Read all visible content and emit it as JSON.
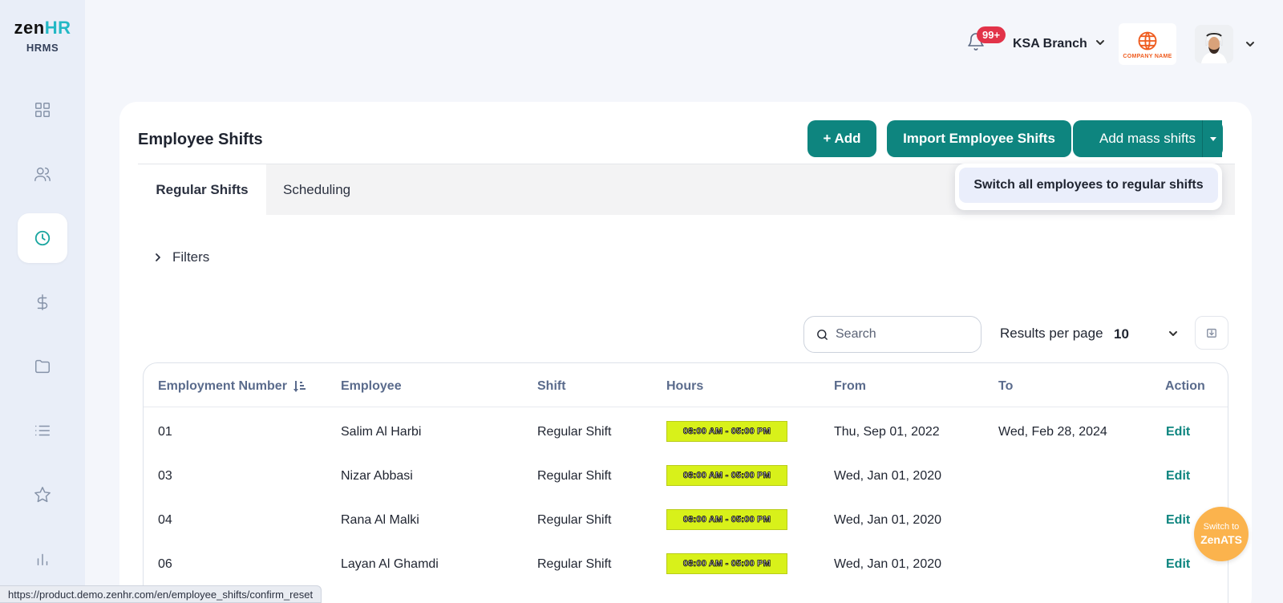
{
  "app": {
    "logo_prefix": "zen",
    "logo_suffix": "HR",
    "logo_sub": "HRMS"
  },
  "sidebar": {
    "items": [
      {
        "icon": "dashboard-icon",
        "active": false
      },
      {
        "icon": "users-icon",
        "active": false
      },
      {
        "icon": "clock-icon",
        "active": true
      },
      {
        "icon": "dollar-icon",
        "active": false
      },
      {
        "icon": "folder-icon",
        "active": false
      },
      {
        "icon": "list-icon",
        "active": false
      },
      {
        "icon": "star-icon",
        "active": false
      },
      {
        "icon": "bar-chart-icon",
        "active": false
      }
    ]
  },
  "header": {
    "notifications_badge": "99+",
    "branch": "KSA Branch",
    "company_logo_text": "COMPANY NAME"
  },
  "page": {
    "title": "Employee Shifts",
    "buttons": {
      "add": "+ Add",
      "import": "Import Employee Shifts",
      "mass": "Add mass shifts"
    },
    "dropdown_item": "Switch all employees to regular shifts",
    "tabs": [
      {
        "label": "Regular Shifts",
        "active": true
      },
      {
        "label": "Scheduling",
        "active": false
      }
    ],
    "filters_label": "Filters",
    "search_placeholder": "Search",
    "results_per_page_label": "Results per page",
    "results_per_page_value": "10"
  },
  "table": {
    "columns": [
      "Employment Number",
      "Employee",
      "Shift",
      "Hours",
      "From",
      "To",
      "Action"
    ],
    "rows": [
      {
        "number": "01",
        "employee": "Salim Al Harbi",
        "shift": "Regular Shift",
        "hours": "08:00 AM - 05:00 PM",
        "from": "Thu, Sep 01, 2022",
        "to": "Wed, Feb 28, 2024",
        "action": "Edit"
      },
      {
        "number": "03",
        "employee": "Nizar Abbasi",
        "shift": "Regular Shift",
        "hours": "08:00 AM - 05:00 PM",
        "from": "Wed, Jan 01, 2020",
        "to": "",
        "action": "Edit"
      },
      {
        "number": "04",
        "employee": "Rana Al Malki",
        "shift": "Regular Shift",
        "hours": "08:00 AM - 05:00 PM",
        "from": "Wed, Jan 01, 2020",
        "to": "",
        "action": "Edit"
      },
      {
        "number": "06",
        "employee": "Layan Al Ghamdi",
        "shift": "Regular Shift",
        "hours": "08:00 AM - 05:00 PM",
        "from": "Wed, Jan 01, 2020",
        "to": "",
        "action": "Edit"
      }
    ]
  },
  "fab": {
    "line1": "Switch to",
    "line2": "ZenATS"
  },
  "statusbar": {
    "url": "https://product.demo.zenhr.com/en/employee_shifts/confirm_reset"
  },
  "colors": {
    "primary": "#0e857f",
    "accent": "#1aa6a0",
    "hours_badge": "#d8f11a",
    "fab": "#fbb34d",
    "badge": "#e23349"
  }
}
